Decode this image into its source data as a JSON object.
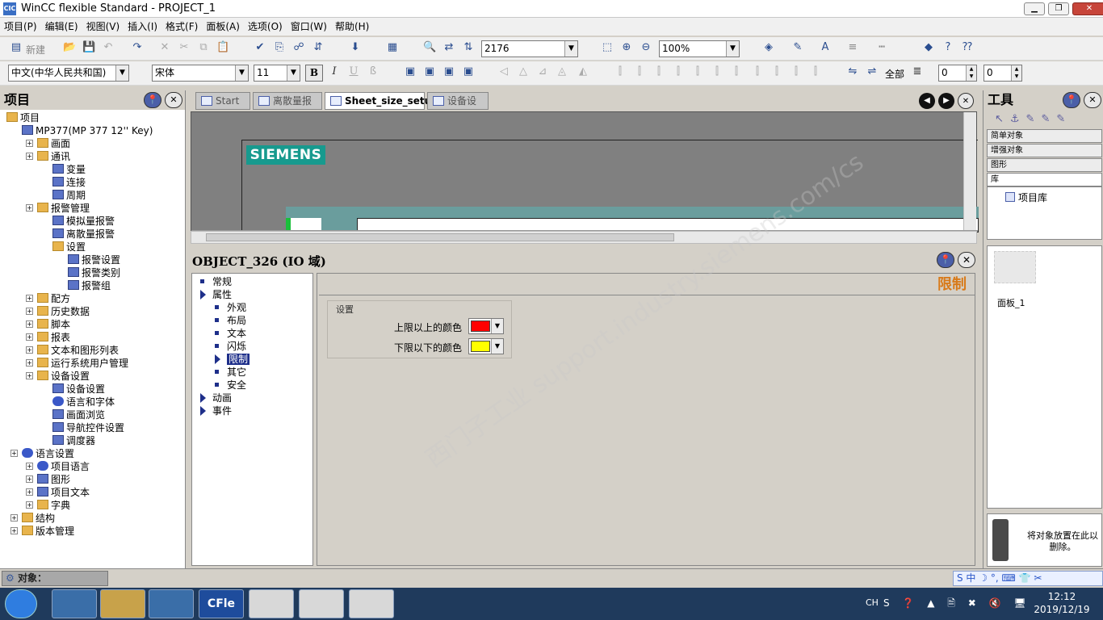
{
  "window": {
    "title": "WinCC flexible Standard - PROJECT_1"
  },
  "menu": [
    "项目(P)",
    "编辑(E)",
    "视图(V)",
    "插入(I)",
    "格式(F)",
    "面板(A)",
    "选项(O)",
    "窗口(W)",
    "帮助(H)"
  ],
  "toolbar1": {
    "new_label": "新建",
    "object_number": "2176",
    "zoom": "100%"
  },
  "toolbar2": {
    "language": "中文(中华人民共和国)",
    "font": "宋体",
    "font_size": "11",
    "bold": "B",
    "italic": "I",
    "underline": "U",
    "all_label": "全部",
    "spin1": "0",
    "spin2": "0"
  },
  "project": {
    "title": "项目",
    "items": [
      {
        "label": "项目",
        "level": 0
      },
      {
        "label": "MP377(MP 377 12'' Key)",
        "level": 1
      },
      {
        "label": "画面",
        "level": 2
      },
      {
        "label": "通讯",
        "level": 2
      },
      {
        "label": "变量",
        "level": 3
      },
      {
        "label": "连接",
        "level": 3
      },
      {
        "label": "周期",
        "level": 3
      },
      {
        "label": "报警管理",
        "level": 2
      },
      {
        "label": "模拟量报警",
        "level": 3
      },
      {
        "label": "离散量报警",
        "level": 3
      },
      {
        "label": "设置",
        "level": 3
      },
      {
        "label": "报警设置",
        "level": 4
      },
      {
        "label": "报警类别",
        "level": 4
      },
      {
        "label": "报警组",
        "level": 4
      },
      {
        "label": "配方",
        "level": 2
      },
      {
        "label": "历史数据",
        "level": 2
      },
      {
        "label": "脚本",
        "level": 2
      },
      {
        "label": "报表",
        "level": 2
      },
      {
        "label": "文本和图形列表",
        "level": 2
      },
      {
        "label": "运行系统用户管理",
        "level": 2
      },
      {
        "label": "设备设置",
        "level": 2
      },
      {
        "label": "设备设置",
        "level": 3
      },
      {
        "label": "语言和字体",
        "level": 3
      },
      {
        "label": "画面浏览",
        "level": 3
      },
      {
        "label": "导航控件设置",
        "level": 3
      },
      {
        "label": "调度器",
        "level": 3
      },
      {
        "label": "语言设置",
        "level": 1
      },
      {
        "label": "项目语言",
        "level": 2
      },
      {
        "label": "图形",
        "level": 2
      },
      {
        "label": "项目文本",
        "level": 2
      },
      {
        "label": "字典",
        "level": 2
      },
      {
        "label": "结构",
        "level": 1
      },
      {
        "label": "版本管理",
        "level": 1
      }
    ]
  },
  "tabs": [
    "Start",
    "离散量报警",
    "Sheet_size_setup",
    "设备设置"
  ],
  "canvas": {
    "logo": "SIEMENS"
  },
  "properties": {
    "object_title": "OBJECT_326 (IO 域)",
    "tree": [
      {
        "label": "常规",
        "kind": "sq",
        "level": 0
      },
      {
        "label": "属性",
        "kind": "tri",
        "level": 0
      },
      {
        "label": "外观",
        "kind": "sq",
        "level": 1
      },
      {
        "label": "布局",
        "kind": "sq",
        "level": 1
      },
      {
        "label": "文本",
        "kind": "sq",
        "level": 1
      },
      {
        "label": "闪烁",
        "kind": "sq",
        "level": 1
      },
      {
        "label": "限制",
        "kind": "arrow",
        "level": 1
      },
      {
        "label": "其它",
        "kind": "sq",
        "level": 1
      },
      {
        "label": "安全",
        "kind": "sq",
        "level": 1
      },
      {
        "label": "动画",
        "kind": "tri",
        "level": 0
      },
      {
        "label": "事件",
        "kind": "tri",
        "level": 0
      }
    ],
    "section_title": "限制",
    "group_label": "设置",
    "upper_label": "上限以上的颜色",
    "upper_color": "#ff0000",
    "lower_label": "下限以下的颜色",
    "lower_color": "#ffff00"
  },
  "tools": {
    "title": "工具",
    "categories": [
      "简单对象",
      "增强对象",
      "图形",
      "库"
    ],
    "library_item": "项目库",
    "faceplate": "面板_1",
    "trash_hint": "将对象放置在此以删除。"
  },
  "status": {
    "objects_label": "对象："
  },
  "taskbar": {
    "lang": "CH",
    "time": "12:12",
    "date": "2019/12/19",
    "app_label": "CFle"
  }
}
